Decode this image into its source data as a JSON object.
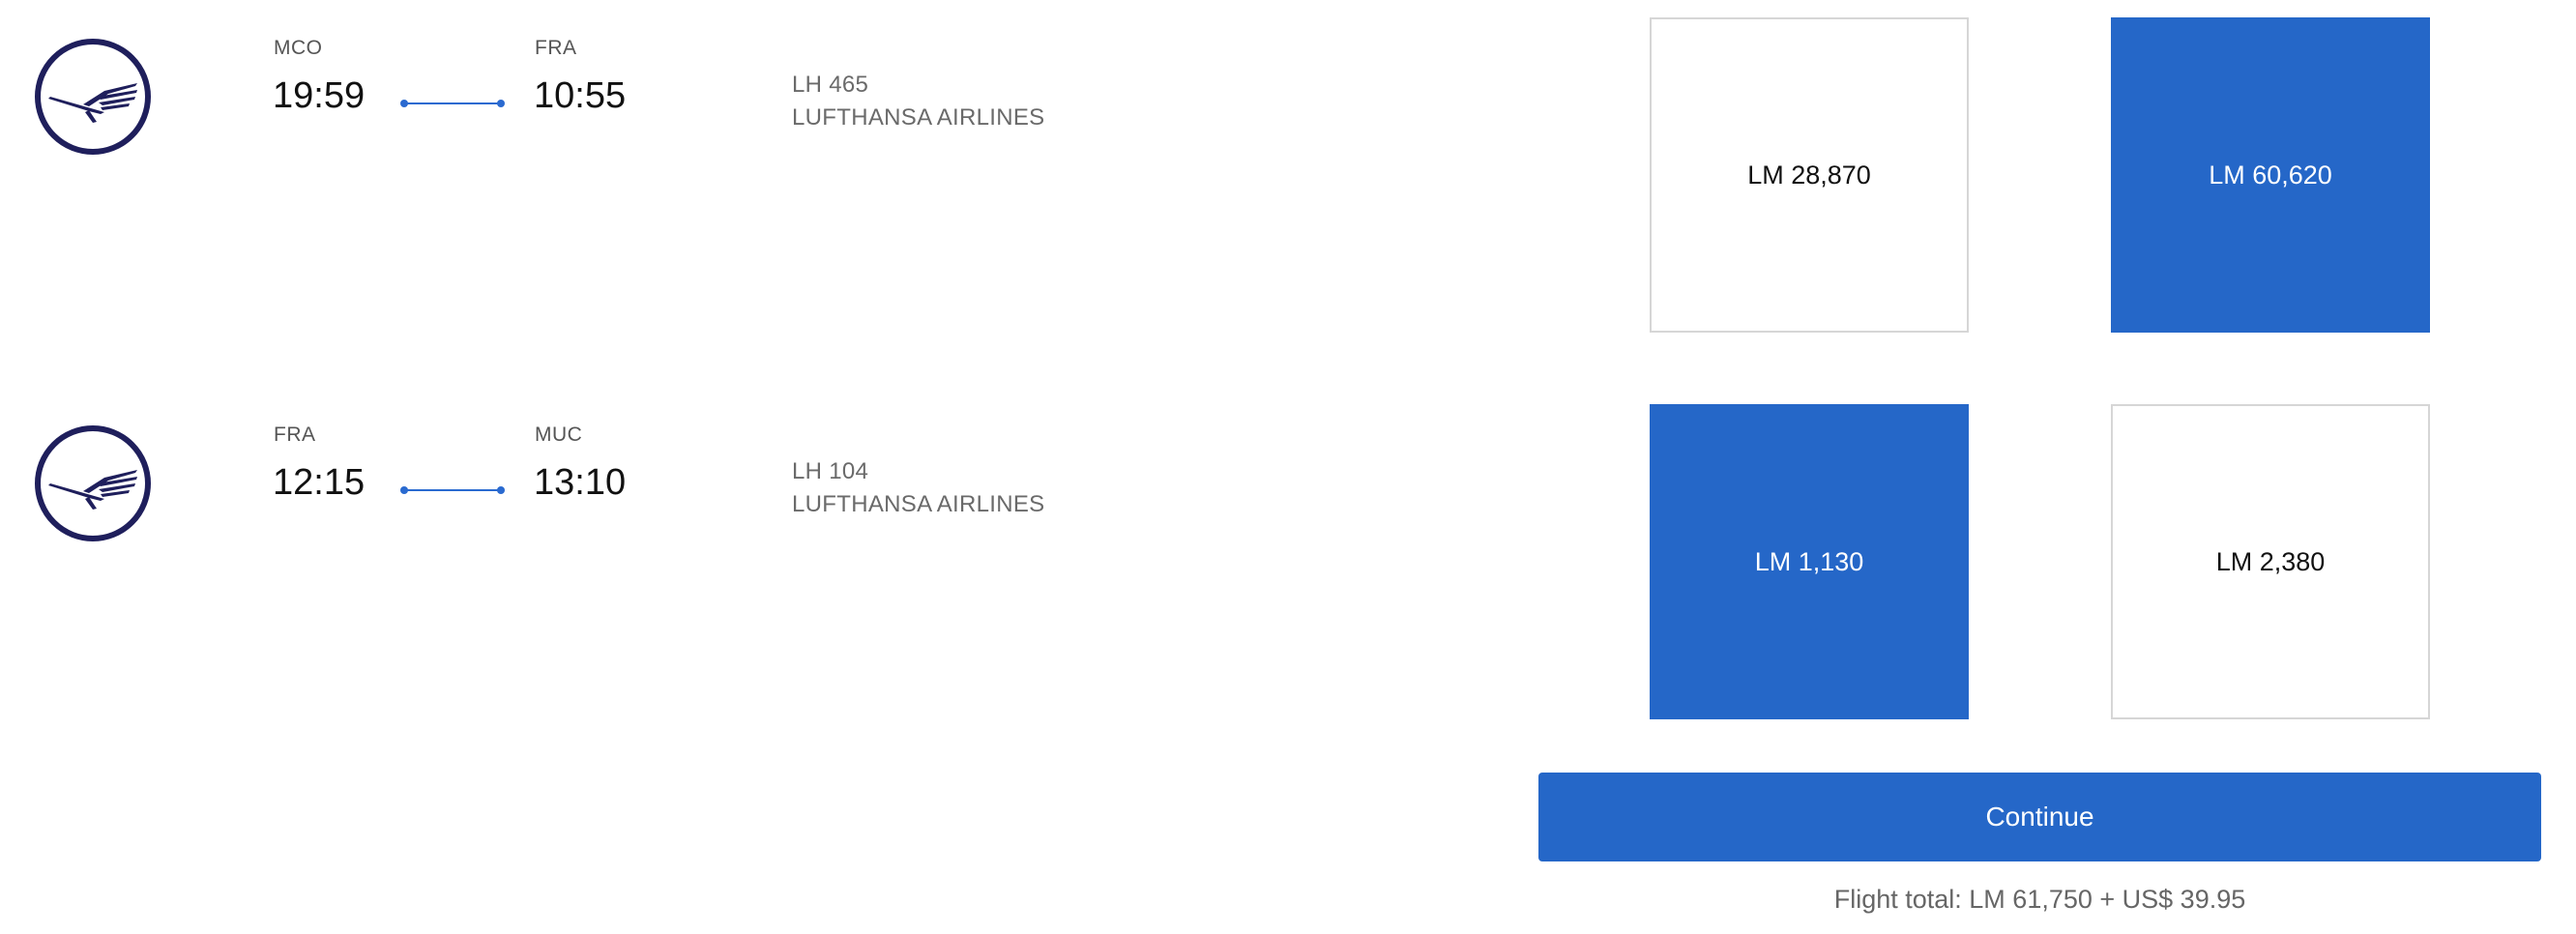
{
  "flights": [
    {
      "origin": "MCO",
      "destination": "FRA",
      "departure_time": "19:59",
      "arrival_time": "10:55",
      "flight_number": "LH 465",
      "airline": "LUFTHANSA AIRLINES",
      "fares": [
        {
          "price": "LM 28,870",
          "selected": false
        },
        {
          "price": "LM 60,620",
          "selected": true
        }
      ]
    },
    {
      "origin": "FRA",
      "destination": "MUC",
      "departure_time": "12:15",
      "arrival_time": "13:10",
      "flight_number": "LH 104",
      "airline": "LUFTHANSA AIRLINES",
      "fares": [
        {
          "price": "LM 1,130",
          "selected": true
        },
        {
          "price": "LM 2,380",
          "selected": false
        }
      ]
    }
  ],
  "icons": {
    "airline_logo": "lufthansa-crane-icon"
  },
  "colors": {
    "accent": "#2567c8",
    "logo": "#1f1f5c",
    "border": "#d6d6d6"
  },
  "footer": {
    "continue_label": "Continue",
    "total_text": "Flight total: LM 61,750 + US$ 39.95"
  }
}
